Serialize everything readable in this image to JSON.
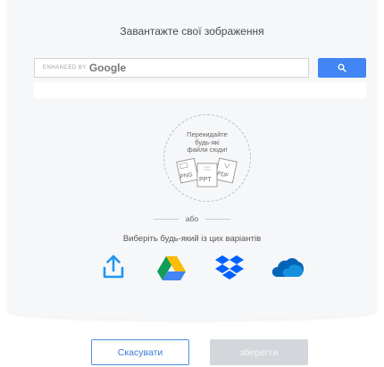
{
  "dialog": {
    "title": "Завантажте свої зображення"
  },
  "search": {
    "enhanced_label": "ENHANCED BY",
    "brand": "Google",
    "button_icon": "search-icon"
  },
  "drop_zone": {
    "text_line1": "Перекидайте",
    "text_line2": "будь-які",
    "text_line3": "файли сюди!",
    "file_types": [
      "PNG",
      "PPT",
      "PDF"
    ]
  },
  "divider": {
    "or_label": "або"
  },
  "choose_label": "Виберіть будь-який із цих варіантів",
  "sources": [
    {
      "icon": "upload-icon"
    },
    {
      "icon": "google-drive-icon"
    },
    {
      "icon": "dropbox-icon"
    },
    {
      "icon": "onedrive-icon"
    }
  ],
  "footer": {
    "cancel_label": "Скасувати",
    "save_label": "зберегти"
  },
  "colors": {
    "accent": "#4285f4",
    "upload": "#2196f3",
    "dropbox": "#0061fe",
    "onedrive": "#0364b8"
  }
}
